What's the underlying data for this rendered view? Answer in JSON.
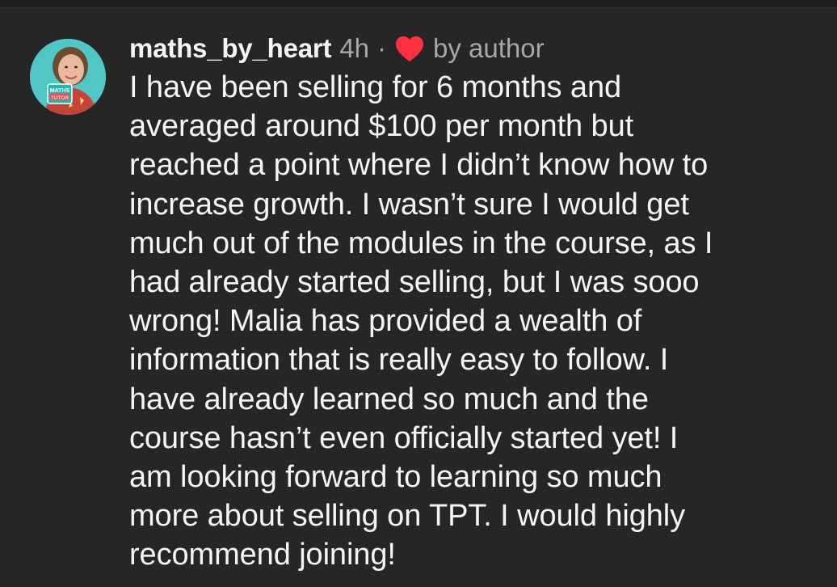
{
  "comment": {
    "username": "maths_by_heart",
    "time": "4h",
    "separator": "·",
    "liked_label": "by author",
    "avatar_badge": "MATHS TUTOR",
    "lines": [
      "I have been selling for 6 months and",
      "averaged around $100 per month but",
      "reached a point where I didn’t know how to",
      "increase growth. I wasn’t sure I would get",
      "much out of the modules in the course, as I",
      "had already started selling, but I was sooo",
      "wrong! Malia has provided a wealth of",
      "information that is really easy to follow. I",
      "have already learned so much and the",
      "course hasn’t even officially started yet! I",
      "am looking forward to learning so much",
      "more about selling on TPT. I would highly",
      "recommend joining!"
    ]
  },
  "icons": {
    "heart": "heart-icon",
    "avatar": "avatar"
  },
  "colors": {
    "background": "#262626",
    "text": "#f5f5f5",
    "muted": "#a8a8a8",
    "heart": "#ff3040",
    "avatar_bg": "#4fc7c4"
  }
}
